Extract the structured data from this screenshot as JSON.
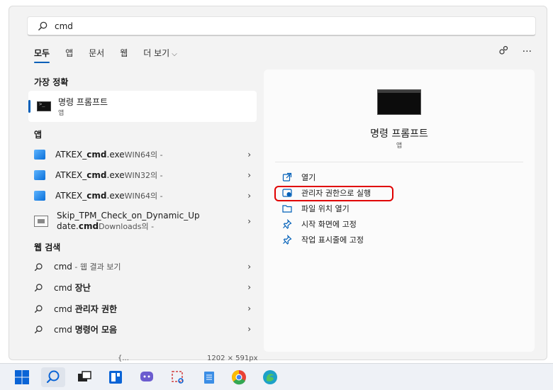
{
  "search": {
    "query": "cmd"
  },
  "tabs": [
    {
      "label": "모두",
      "active": true
    },
    {
      "label": "앱"
    },
    {
      "label": "문서"
    },
    {
      "label": "웹"
    },
    {
      "label": "더 보기"
    }
  ],
  "header_icons": [
    "share-icon",
    "more-icon"
  ],
  "sections": {
    "best_match": "가장 정확",
    "apps": "앱",
    "web": "웹 검색"
  },
  "best_match": {
    "title": "명령 프롬프트",
    "subtitle": "앱"
  },
  "apps": [
    {
      "prefix": "ATKEX_",
      "bold": "cmd",
      "suffix": ".exe",
      "sub": "WIN64의 -"
    },
    {
      "prefix": "ATKEX_",
      "bold": "cmd",
      "suffix": ".exe",
      "sub": "WIN32의 -"
    },
    {
      "prefix": "ATKEX_",
      "bold": "cmd",
      "suffix": ".exe",
      "sub": "WIN64의 -"
    },
    {
      "line1": "Skip_TPM_Check_on_Dynamic_Up",
      "line2_prefix": "date.",
      "line2_bold": "cmd",
      "sub": "Downloads의 -"
    }
  ],
  "web": [
    {
      "term": "cmd",
      "bold": "",
      "suffix": " - 웹 결과 보기"
    },
    {
      "term": "cmd ",
      "bold": "장난",
      "suffix": ""
    },
    {
      "term": "cmd ",
      "bold": "관리자 권한",
      "suffix": ""
    },
    {
      "term": "cmd ",
      "bold": "명령어 모음",
      "suffix": ""
    }
  ],
  "right_panel": {
    "title": "명령 프롬프트",
    "subtitle": "앱",
    "actions": [
      "열기",
      "관리자 권한으로 실행",
      "파일 위치 열기",
      "시작 화면에 고정",
      "작업 표시줄에 고정"
    ]
  },
  "taskbar_fragments": {
    "left": "{...",
    "right": "1202 × 591px"
  },
  "colors": {
    "accent": "#005fb8",
    "highlight": "#e00000"
  }
}
